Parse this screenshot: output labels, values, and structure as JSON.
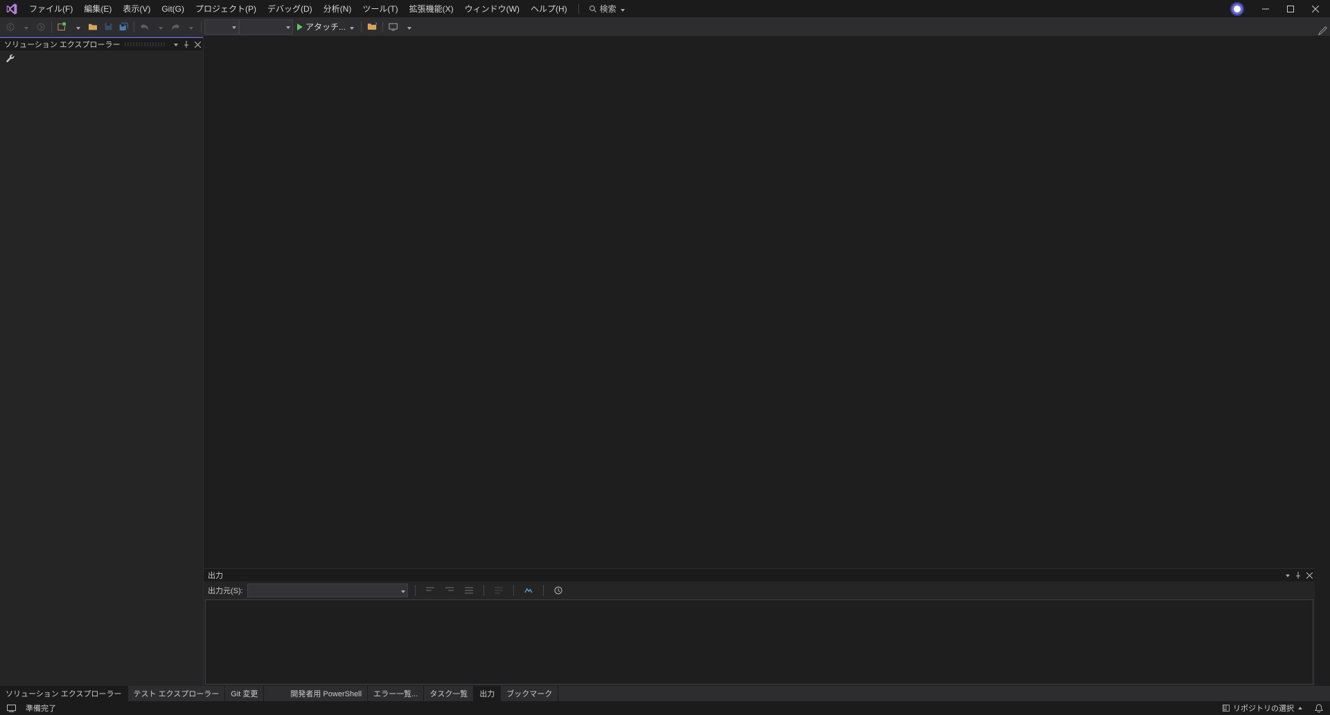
{
  "menu": {
    "items": [
      "ファイル(F)",
      "編集(E)",
      "表示(V)",
      "Git(G)",
      "プロジェクト(P)",
      "デバッグ(D)",
      "分析(N)",
      "ツール(T)",
      "拡張機能(X)",
      "ウィンドウ(W)",
      "ヘルプ(H)"
    ],
    "search_label": "検索"
  },
  "toolbar": {
    "attach_label": "アタッチ..."
  },
  "solution_explorer": {
    "title": "ソリューション エクスプローラー"
  },
  "output": {
    "title": "出力",
    "source_label": "出力元(S):"
  },
  "left_tabs": [
    "ソリューション エクスプローラー",
    "テスト エクスプローラー",
    "Git 変更"
  ],
  "right_tabs": [
    "開発者用 PowerShell",
    "エラー一覧...",
    "タスク一覧",
    "出力",
    "ブックマーク"
  ],
  "right_tabs_active_index": 3,
  "status": {
    "ready": "準備完了",
    "repo_select": "リポジトリの選択"
  }
}
